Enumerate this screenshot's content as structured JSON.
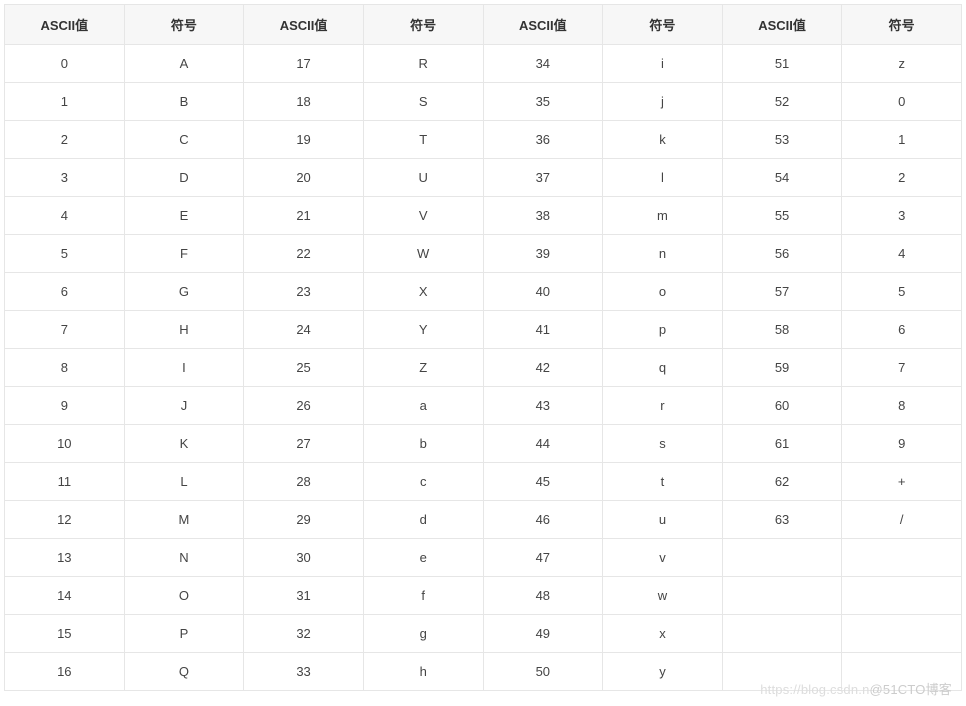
{
  "headers": [
    "ASCII值",
    "符号",
    "ASCII值",
    "符号",
    "ASCII值",
    "符号",
    "ASCII值",
    "符号"
  ],
  "rows": [
    [
      "0",
      "A",
      "17",
      "R",
      "34",
      "i",
      "51",
      "z"
    ],
    [
      "1",
      "B",
      "18",
      "S",
      "35",
      "j",
      "52",
      "0"
    ],
    [
      "2",
      "C",
      "19",
      "T",
      "36",
      "k",
      "53",
      "1"
    ],
    [
      "3",
      "D",
      "20",
      "U",
      "37",
      "l",
      "54",
      "2"
    ],
    [
      "4",
      "E",
      "21",
      "V",
      "38",
      "m",
      "55",
      "3"
    ],
    [
      "5",
      "F",
      "22",
      "W",
      "39",
      "n",
      "56",
      "4"
    ],
    [
      "6",
      "G",
      "23",
      "X",
      "40",
      "o",
      "57",
      "5"
    ],
    [
      "7",
      "H",
      "24",
      "Y",
      "41",
      "p",
      "58",
      "6"
    ],
    [
      "8",
      "I",
      "25",
      "Z",
      "42",
      "q",
      "59",
      "7"
    ],
    [
      "9",
      "J",
      "26",
      "a",
      "43",
      "r",
      "60",
      "8"
    ],
    [
      "10",
      "K",
      "27",
      "b",
      "44",
      "s",
      "61",
      "9"
    ],
    [
      "11",
      "L",
      "28",
      "c",
      "45",
      "t",
      "62",
      "+"
    ],
    [
      "12",
      "M",
      "29",
      "d",
      "46",
      "u",
      "63",
      "/"
    ],
    [
      "13",
      "N",
      "30",
      "e",
      "47",
      "v",
      "",
      ""
    ],
    [
      "14",
      "O",
      "31",
      "f",
      "48",
      "w",
      "",
      ""
    ],
    [
      "15",
      "P",
      "32",
      "g",
      "49",
      "x",
      "",
      ""
    ],
    [
      "16",
      "Q",
      "33",
      "h",
      "50",
      "y",
      "",
      ""
    ]
  ],
  "watermark": {
    "faded": "https://blog.csdn.n",
    "main": "@51CTO博客"
  }
}
